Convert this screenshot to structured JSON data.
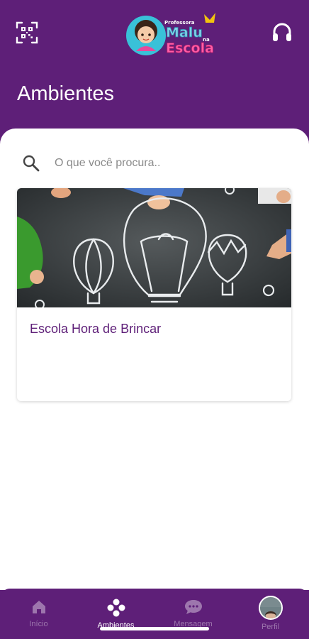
{
  "header": {
    "logo_line1": "Professora",
    "logo_line2": "Malu",
    "logo_line3": "na",
    "logo_line4": "Escola",
    "page_title": "Ambientes",
    "qr_icon": "qr-code-icon",
    "support_icon": "headset-icon"
  },
  "search": {
    "placeholder": "O que você procura.."
  },
  "cards": [
    {
      "title": "Escola Hora de Brincar",
      "image": "chalkboard-balloons-image"
    }
  ],
  "tabbar": {
    "tabs": [
      {
        "label": "Início",
        "icon": "home-icon",
        "active": false
      },
      {
        "label": "Ambientes",
        "icon": "ambientes-icon",
        "active": true
      },
      {
        "label": "Mensagem",
        "icon": "chat-icon",
        "active": false
      },
      {
        "label": "Perfil",
        "icon": "avatar",
        "active": false
      }
    ]
  },
  "colors": {
    "brand": "#5e1f78",
    "inactive_tab": "#9d76ad",
    "surface": "#ffffff"
  }
}
